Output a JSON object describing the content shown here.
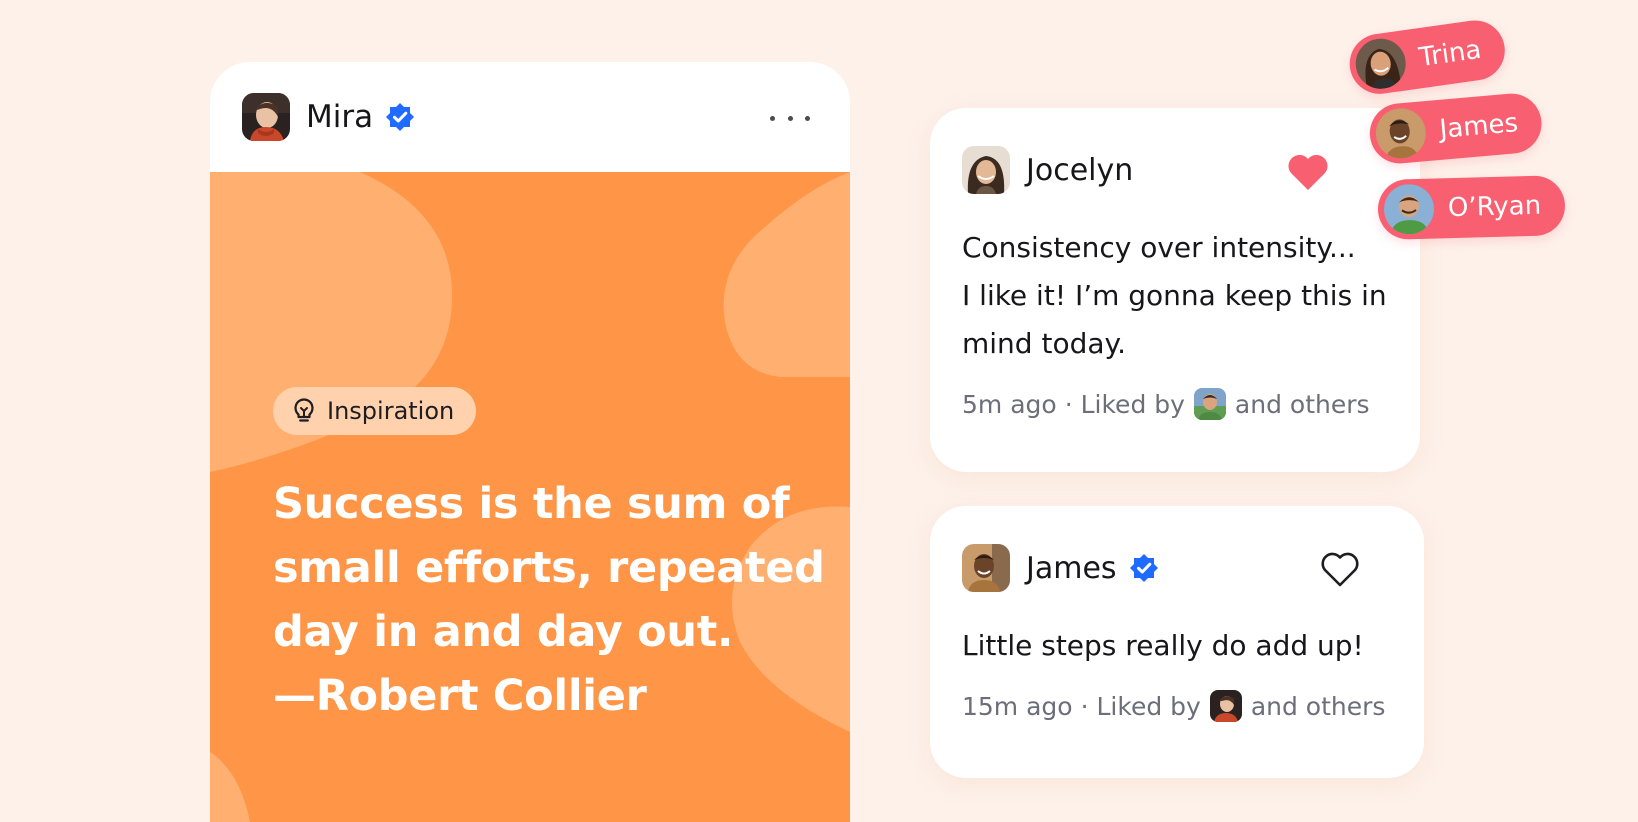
{
  "post": {
    "author": "Mira",
    "tag": "Inspiration",
    "quote_lines": [
      "Success is the sum of",
      "small efforts, repeated",
      "day in and day out.",
      "—Robert Collier"
    ]
  },
  "comments": [
    {
      "author": "Jocelyn",
      "verified": false,
      "liked": true,
      "text_lines": [
        "Consistency over intensity...",
        "I like it! I’m gonna keep this in",
        "mind today."
      ],
      "time": "5m ago",
      "liked_by_prefix": "· Liked by",
      "liked_by_suffix": "and others"
    },
    {
      "author": "James",
      "verified": true,
      "liked": false,
      "text_lines": [
        "Little steps really do add up!"
      ],
      "time": "15m ago",
      "liked_by_prefix": "· Liked by",
      "liked_by_suffix": "and others"
    }
  ],
  "likers": [
    "Trina",
    "James",
    "O’Ryan"
  ],
  "icons": {
    "more": "more-horizontal-icon",
    "verified": "verified-badge-icon",
    "tag": "lightbulb-icon",
    "heart_filled": "heart-filled-icon",
    "heart_outline": "heart-outline-icon"
  },
  "colors": {
    "background": "#fdf1ea",
    "post_body": "#ff9546",
    "post_blob": "#ffb071",
    "tag_chip": "#ffd2ad",
    "accent_pink": "#f85f70",
    "verified_blue": "#1f6bff",
    "meta_text": "#6e6e7b"
  }
}
